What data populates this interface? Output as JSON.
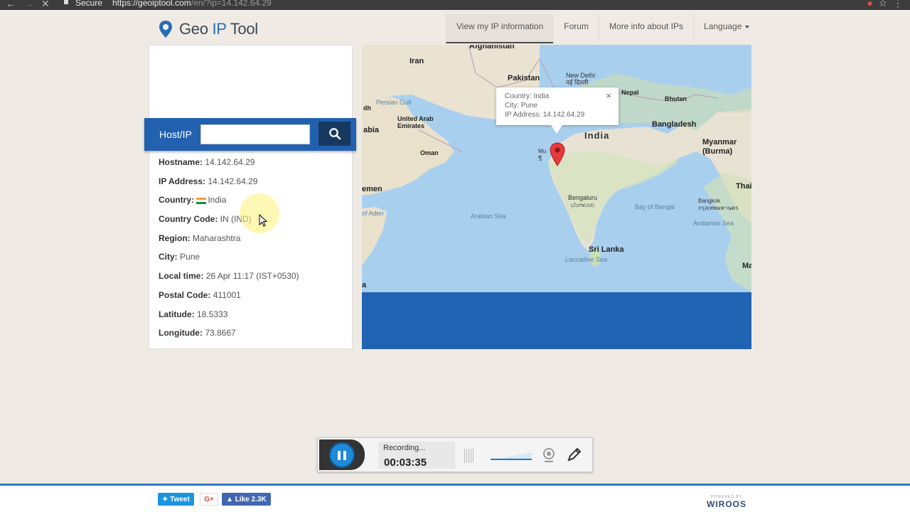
{
  "browser": {
    "secure_label": "Secure",
    "url_host": "https://geoiptool.com",
    "url_path": "/en/?ip=14.142.64.29"
  },
  "header": {
    "logo_geo": "Geo",
    "logo_ip": "IP",
    "logo_tool": "Tool",
    "nav": [
      {
        "label": "View my IP information",
        "active": true
      },
      {
        "label": "Forum"
      },
      {
        "label": "More info about IPs"
      },
      {
        "label": "Language"
      }
    ]
  },
  "search": {
    "label": "Host/IP",
    "value": ""
  },
  "info": [
    {
      "key": "Hostname:",
      "value": "14.142.64.29"
    },
    {
      "key": "IP Address:",
      "value": "14.142.64.29"
    },
    {
      "key": "Country:",
      "value": "India"
    },
    {
      "key": "Country Code:",
      "value": "IN (IND)"
    },
    {
      "key": "Region:",
      "value": "Maharashtra"
    },
    {
      "key": "City:",
      "value": "Pune"
    },
    {
      "key": "Local time:",
      "value": "26 Apr 11:17 (IST+0530)"
    },
    {
      "key": "Postal Code:",
      "value": "411001"
    },
    {
      "key": "Latitude:",
      "value": "18.5333"
    },
    {
      "key": "Longitude:",
      "value": "73.8667"
    }
  ],
  "map": {
    "labels": {
      "afghanistan": "Afghanistan",
      "iran": "Iran",
      "pakistan": "Pakistan",
      "new_delhi": "New Delhi",
      "new_delhi_hi": "नई दिल्ली",
      "nepal": "Nepal",
      "bhutan": "Bhutan",
      "persian_gulf": "Persian Gulf",
      "uae": "United Arab\nEmirates",
      "dh": "dh",
      "abia": "abia",
      "oman": "Oman",
      "india": "India",
      "bangladesh": "Bangladesh",
      "myanmar": "Myanmar\n(Burma)",
      "thai": "Thai",
      "emen": "emen",
      "aden": "of Aden",
      "arabian_sea": "Arabian Sea",
      "bengaluru": "Bengaluru",
      "bengaluru_kn": "ಬೆಂಗಳೂರು",
      "bay_of_bengal": "Bay of Bengal",
      "bangkok": "Bangkok",
      "bangkok_th": "กรุงเทพมหานคร",
      "andaman_sea": "Andaman Sea",
      "sri_lanka": "Sri Lanka",
      "laccadive_sea": "Laccadive Sea",
      "ma": "Ma",
      "a": "a",
      "mu": "Mu",
      "mu_sub": "मुं"
    },
    "popup": {
      "country": "Country: India",
      "city": "City: Pune",
      "ip": "IP Address: 14.142.64.29",
      "close": "×"
    }
  },
  "recorder": {
    "status": "Recording...",
    "timer": "00:03:35"
  },
  "footer": {
    "tweet": "Tweet",
    "gplus": "G+",
    "fb_like": "Like 2.3K",
    "powered_by": "POWERED BY",
    "brand": "WIROOS"
  }
}
